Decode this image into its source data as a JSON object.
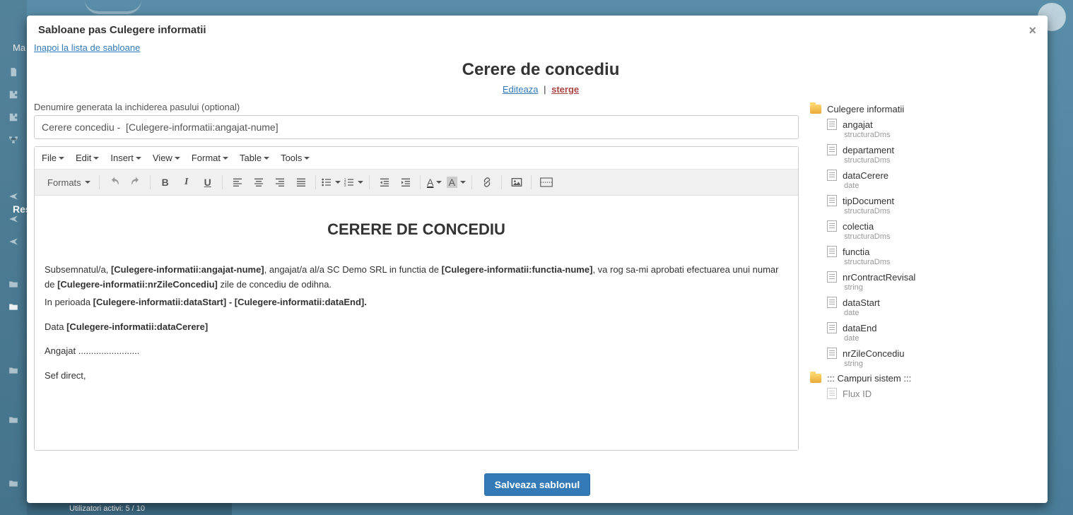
{
  "backdrop": {
    "ma_text": "Ma",
    "res_text": "Res",
    "bottom_status": "Utilizatori activi: 5 / 10"
  },
  "modal": {
    "title": "Sabloane pas Culegere informatii",
    "back_link": "Inapoi la lista de sabloane",
    "template_title": "Cerere de concediu",
    "edit_label": "Editeaza",
    "separator": "|",
    "delete_label": "sterge",
    "name_field_label": "Denumire generata la inchiderea pasului (optional)",
    "name_field_value": "Cerere concediu -  [Culegere-informatii:angajat-nume]",
    "save_button": "Salveaza sablonul"
  },
  "editor": {
    "menus": {
      "file": "File",
      "edit": "Edit",
      "insert": "Insert",
      "view": "View",
      "format": "Format",
      "table": "Table",
      "tools": "Tools"
    },
    "toolbar": {
      "formats": "Formats"
    },
    "content": {
      "heading": "CERERE DE CONCEDIU",
      "p1_a": "Subsemnatul/a, ",
      "p1_b": "[Culegere-informatii:angajat-nume]",
      "p1_c": ", angajat/a al/a SC Demo SRL in functia de  ",
      "p1_d": "[Culegere-informatii:functia-nume]",
      "p1_e": ", va rog sa-mi aprobati efectuarea unui numar de  ",
      "p1_f": "[Culegere-informatii:nrZileConcediu]",
      "p1_g": " zile de concediu de odihna.",
      "p2_a": "In perioada ",
      "p2_b": "[Culegere-informatii:dataStart]",
      "p2_c": " - ",
      "p2_d": "[Culegere-informatii:dataEnd].",
      "p3_a": "Data ",
      "p3_b": "[Culegere-informatii:dataCerere]",
      "p4": "Angajat ........................",
      "p5": "Sef direct,"
    }
  },
  "tree": {
    "root1": "Culegere informatii",
    "fields": [
      {
        "name": "angajat",
        "type": "structuraDms"
      },
      {
        "name": "departament",
        "type": "structuraDms"
      },
      {
        "name": "dataCerere",
        "type": "date"
      },
      {
        "name": "tipDocument",
        "type": "structuraDms"
      },
      {
        "name": "colectia",
        "type": "structuraDms"
      },
      {
        "name": "functia",
        "type": "structuraDms"
      },
      {
        "name": "nrContractRevisal",
        "type": "string"
      },
      {
        "name": "dataStart",
        "type": "date"
      },
      {
        "name": "dataEnd",
        "type": "date"
      },
      {
        "name": "nrZileConcediu",
        "type": "string"
      }
    ],
    "root2": "::: Campuri sistem :::",
    "root2_child": "Flux ID"
  }
}
